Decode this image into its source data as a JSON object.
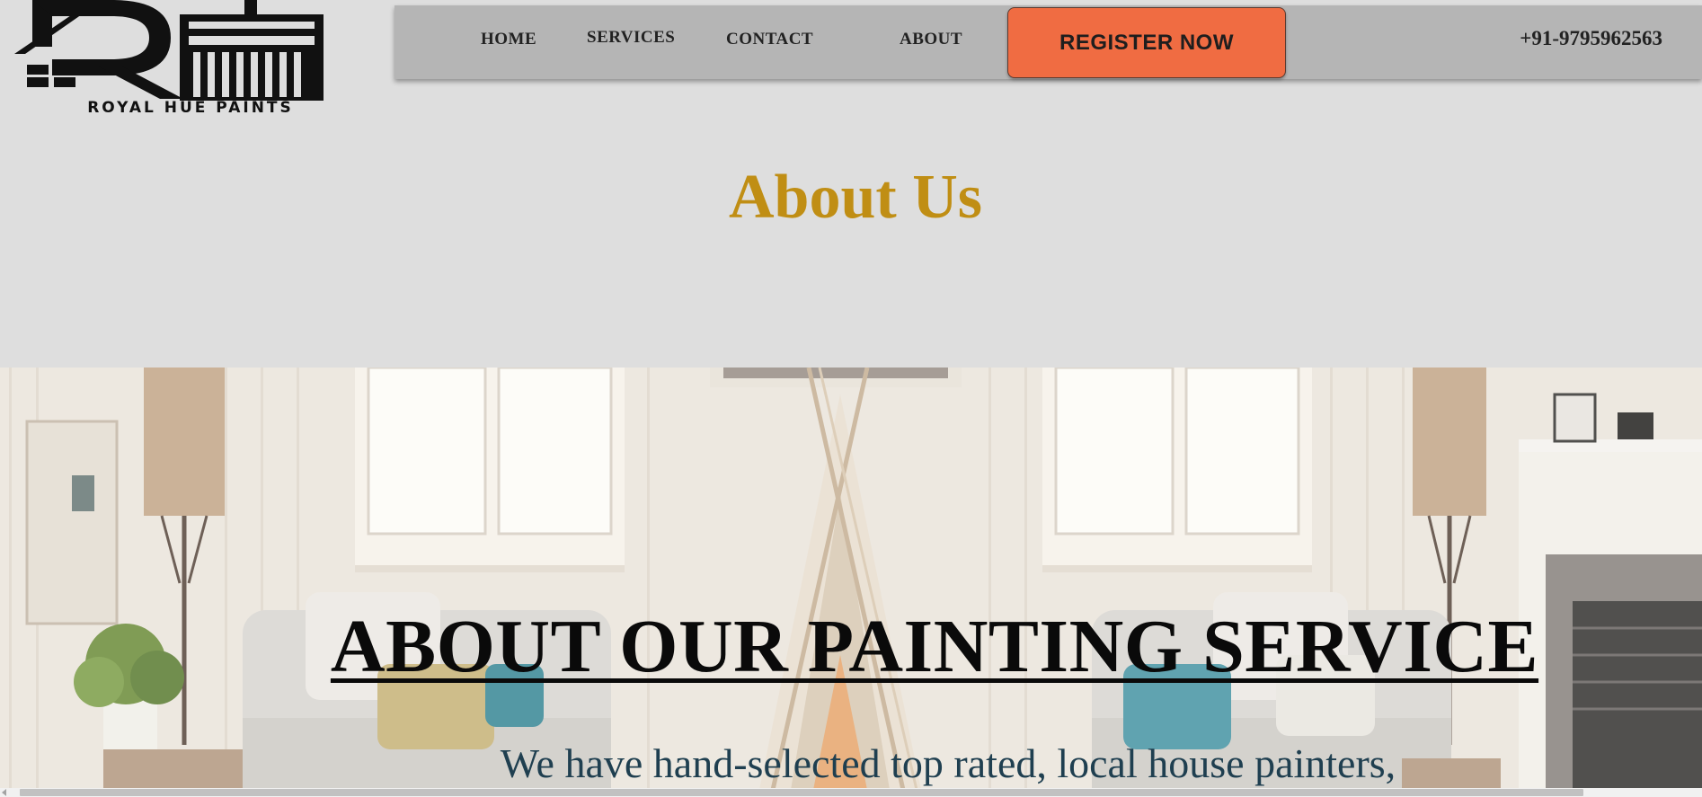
{
  "brand": {
    "name": "ROYAL HUE PAINTS",
    "logo_icon": "house-paintbrush-logo",
    "accent_color": "#c08e14"
  },
  "nav": {
    "items": [
      {
        "label": "HOME"
      },
      {
        "label": "SERVICES"
      },
      {
        "label": "CONTACT"
      },
      {
        "label": "ABOUT"
      }
    ],
    "cta_label": "REGISTER NOW",
    "cta_color": "#f06c42",
    "phone": "+91-9795962563"
  },
  "about": {
    "heading": "About Us"
  },
  "hero": {
    "title": "ABOUT OUR PAINTING SERVICE",
    "subtitle": "We have hand-selected top rated, local house painters,"
  }
}
